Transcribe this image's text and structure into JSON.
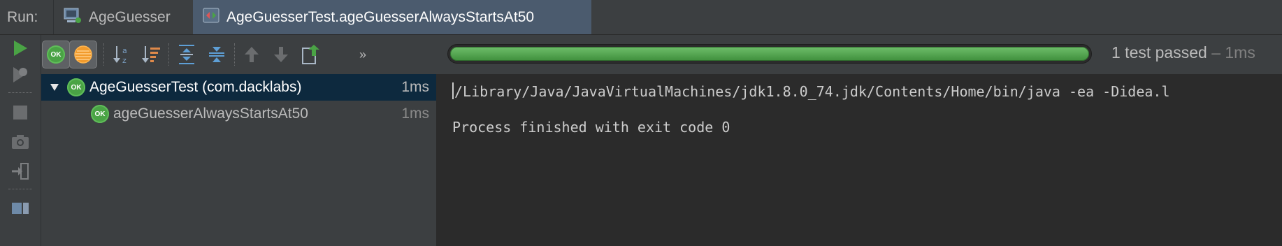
{
  "run_label": "Run:",
  "tabs": [
    {
      "label": "AgeGuesser",
      "icon": "run-config-icon",
      "active": false
    },
    {
      "label": "AgeGuesserTest.ageGuesserAlwaysStartsAt50",
      "icon": "test-class-icon",
      "active": true
    }
  ],
  "toolbar": {
    "ok_badge": "OK",
    "more": "»"
  },
  "progress": {
    "fraction": 1.0,
    "color": "#4aa345"
  },
  "status": {
    "passed": "1 test passed",
    "duration": " – 1ms"
  },
  "tree": [
    {
      "label": "AgeGuesserTest (com.dacklabs)",
      "time": "1ms",
      "badge": "OK",
      "expanded": true,
      "selected": true
    },
    {
      "label": "ageGuesserAlwaysStartsAt50",
      "time": "1ms",
      "badge": "OK",
      "selected": false
    }
  ],
  "console": {
    "command": "/Library/Java/JavaVirtualMachines/jdk1.8.0_74.jdk/Contents/Home/bin/java -ea -Didea.l",
    "exit_message": "Process finished with exit code 0"
  }
}
